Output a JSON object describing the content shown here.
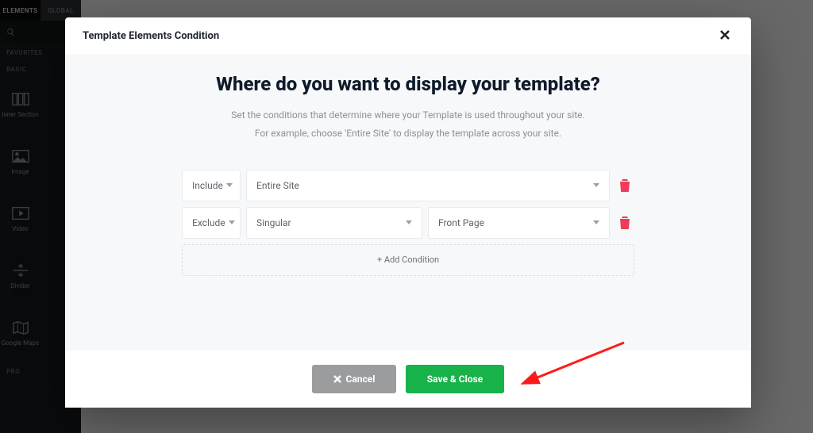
{
  "sidebar": {
    "tab_elements": "ELEMENTS",
    "tab_global": "GLOBAL",
    "cat_favorites": "FAVORITES",
    "cat_basic": "BASIC",
    "cat_pro": "PRO",
    "widgets": {
      "inner_section": "Inner Section",
      "image": "Image",
      "video": "Video",
      "divider": "Divider",
      "google_maps": "Google Maps"
    }
  },
  "modal": {
    "title": "Template Elements Condition",
    "hero_title": "Where do you want to display your template?",
    "hero_sub_line1": "Set the conditions that determine where your Template is used throughout your site.",
    "hero_sub_line2": "For example, choose 'Entire Site' to display the template across your site.",
    "row1": {
      "mode": "Include",
      "scope": "Entire Site"
    },
    "row2": {
      "mode": "Exclude",
      "scope": "Singular",
      "target": "Front Page"
    },
    "add_label": "+ Add Condition",
    "cancel_label": "Cancel",
    "save_label": "Save & Close"
  },
  "colors": {
    "accent_green": "#17b24a",
    "danger": "#ef3b5b"
  }
}
